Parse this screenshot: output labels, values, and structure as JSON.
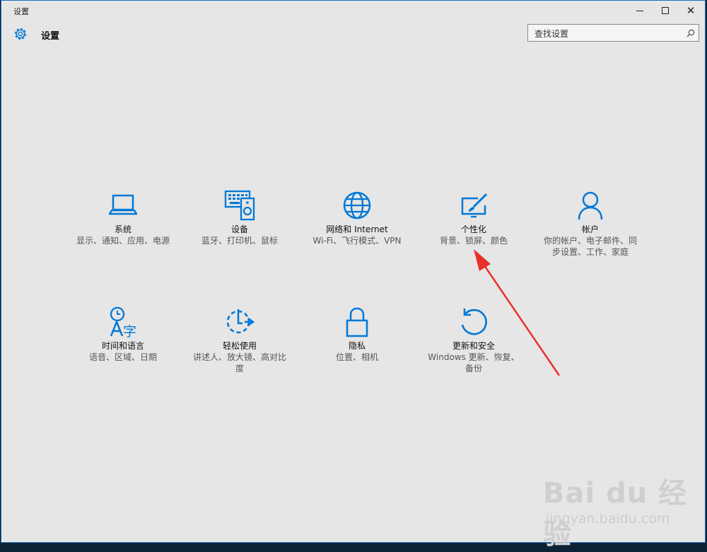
{
  "window": {
    "title": "设置",
    "controls": {
      "minimize": "minimize",
      "maximize": "maximize",
      "close": "✕"
    }
  },
  "header": {
    "title": "设置",
    "icon": "gear-icon"
  },
  "search": {
    "placeholder": "查找设置",
    "icon": "search-icon"
  },
  "accent_color": "#0078d7",
  "tiles": [
    {
      "name": "系统",
      "desc": "显示、通知、应用、电源",
      "icon": "laptop-icon"
    },
    {
      "name": "设备",
      "desc": "蓝牙、打印机、鼠标",
      "icon": "keyboard-speaker-icon"
    },
    {
      "name": "网络和 Internet",
      "desc": "Wi-Fi、飞行模式、VPN",
      "icon": "globe-icon"
    },
    {
      "name": "个性化",
      "desc": "背景、锁屏、颜色",
      "icon": "paint-monitor-icon"
    },
    {
      "name": "帐户",
      "desc": "你的帐户、电子邮件、同步设置、工作、家庭",
      "icon": "person-icon"
    },
    {
      "name": "时间和语言",
      "desc": "语音、区域、日期",
      "icon": "time-language-icon"
    },
    {
      "name": "轻松使用",
      "desc": "讲述人、放大镜、高对比度",
      "icon": "ease-of-access-icon"
    },
    {
      "name": "隐私",
      "desc": "位置、相机",
      "icon": "lock-icon"
    },
    {
      "name": "更新和安全",
      "desc": "Windows 更新、恢复、备份",
      "icon": "refresh-icon"
    }
  ],
  "annotation": {
    "color": "#e8302a",
    "target": "个性化"
  },
  "watermark": {
    "logo": "Bai du 经验",
    "url": "jingyan.baidu.com"
  }
}
